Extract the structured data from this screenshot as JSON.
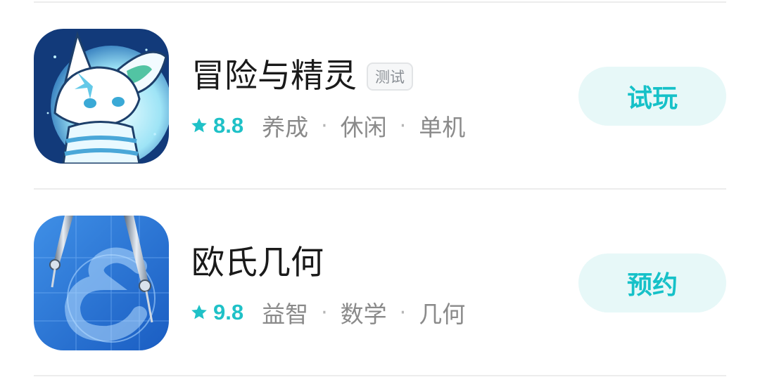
{
  "games": [
    {
      "title": "冒险与精灵",
      "badge": "测试",
      "rating": "8.8",
      "tags": [
        "养成",
        "休闲",
        "单机"
      ],
      "action": "试玩",
      "icon": "fox-spirit-icon"
    },
    {
      "title": "欧氏几何",
      "rating": "9.8",
      "tags": [
        "益智",
        "数学",
        "几何"
      ],
      "action": "预约",
      "icon": "compass-geometry-icon"
    }
  ],
  "colors": {
    "accent": "#16c1c8",
    "button_bg": "#e7f8f8",
    "divider": "#ececec"
  }
}
